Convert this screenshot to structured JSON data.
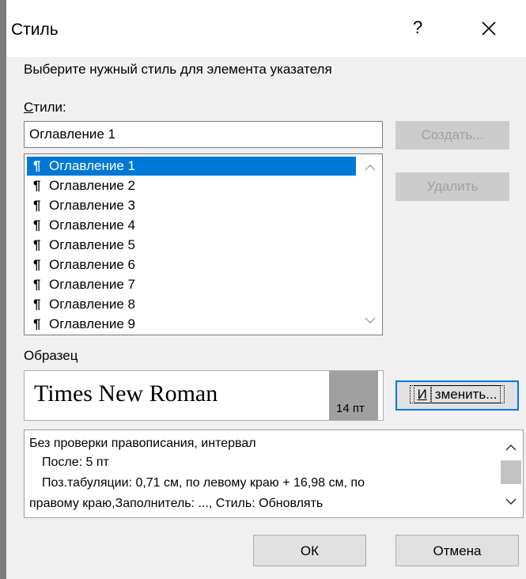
{
  "window": {
    "title": "Стиль",
    "help_label": "?"
  },
  "prompt": "Выберите нужный стиль для элемента указателя",
  "styles": {
    "label_underlined": "С",
    "label_rest": "тили:",
    "input_value": "Оглавление 1",
    "items": [
      {
        "label": "Оглавление 1",
        "selected": true
      },
      {
        "label": "Оглавление 2",
        "selected": false
      },
      {
        "label": "Оглавление 3",
        "selected": false
      },
      {
        "label": "Оглавление 4",
        "selected": false
      },
      {
        "label": "Оглавление 5",
        "selected": false
      },
      {
        "label": "Оглавление 6",
        "selected": false
      },
      {
        "label": "Оглавление 7",
        "selected": false
      },
      {
        "label": "Оглавление 8",
        "selected": false
      },
      {
        "label": "Оглавление 9",
        "selected": false
      }
    ],
    "paragraph_mark": "¶"
  },
  "buttons": {
    "create": "Создать...",
    "delete": "Удалить",
    "modify_underlined": "И",
    "modify_rest": "зменить...",
    "ok": "ОК",
    "cancel": "Отмена"
  },
  "sample": {
    "label": "Образец",
    "font_name": "Times New Roman",
    "size": "14 пт"
  },
  "description": {
    "lines": [
      "Без проверки правописания, интервал",
      "После:  5 пт",
      "Поз.табуляции:  0,71 см, по левому краю +  16,98 см, по",
      "правому краю,Заполнитель: ..., Стиль: Обновлять"
    ]
  },
  "colors": {
    "selection": "#0078d7",
    "disabled_text": "#a0a0a0",
    "dialog_bg": "#f0f0f0"
  }
}
